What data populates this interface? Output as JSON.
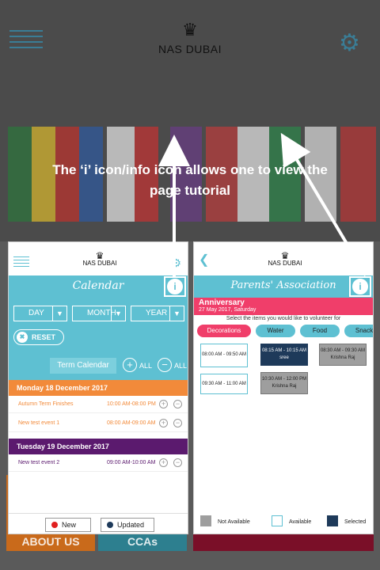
{
  "header": {
    "brand": "NAS DUBAI"
  },
  "caption": "The ‘i’ icon/info icon allows one to view the page tutorial",
  "tiles": [
    {
      "label": "ABOUT US",
      "color": "#c96a1b"
    },
    {
      "label": "CCAs",
      "color": "#2d7f8f"
    },
    {
      "label": "",
      "color": "#7a0f28"
    }
  ],
  "calendar": {
    "brand": "NAS DUBAI",
    "title": "Calendar",
    "info": "i",
    "selects": {
      "day": "DAY",
      "month": "MONTH",
      "year": "YEAR"
    },
    "reset": "RESET",
    "term_calendar": "Term Calendar",
    "all_plus": "ALL",
    "all_minus": "ALL",
    "days": [
      {
        "label": "Monday 18 December 2017",
        "color": "#f28a3a",
        "events": [
          {
            "name": "Autumn Term Finishes",
            "time": "10:00 AM-08:00 PM",
            "color": "#f28a3a"
          },
          {
            "name": "New test event 1",
            "time": "08:00 AM-09:00 AM",
            "color": "#f28a3a"
          }
        ]
      },
      {
        "label": "Tuesday 19 December 2017",
        "color": "#5b1a6e",
        "events": [
          {
            "name": "New test event 2",
            "time": "09:00 AM-10:00 AM",
            "color": "#5b1a6e"
          }
        ]
      }
    ],
    "legend": {
      "new": "New",
      "updated": "Updated"
    }
  },
  "parents": {
    "brand": "NAS DUBAI",
    "title": "Parents' Association",
    "info": "i",
    "event_title": "Anniversary",
    "event_date": "27 May 2017, Saturday",
    "instruction": "Select the items you would like to volunteer for",
    "categories": [
      "Decorations",
      "Water",
      "Food",
      "Snack"
    ],
    "slots": {
      "s1": "08:00 AM - 09:50 AM",
      "s2_time": "08:15 AM - 10:15 AM",
      "s2_name": "sree",
      "s3_time": "08:30 AM - 09:30 AM",
      "s3_name": "Krishna Raj",
      "s4": "09:30 AM - 11:00 AM",
      "s5_time": "10:30 AM - 12:00 PM",
      "s5_name": "Krishna Raj"
    },
    "legend": {
      "not_available": "Not Available",
      "available": "Available",
      "selected": "Selected"
    }
  }
}
